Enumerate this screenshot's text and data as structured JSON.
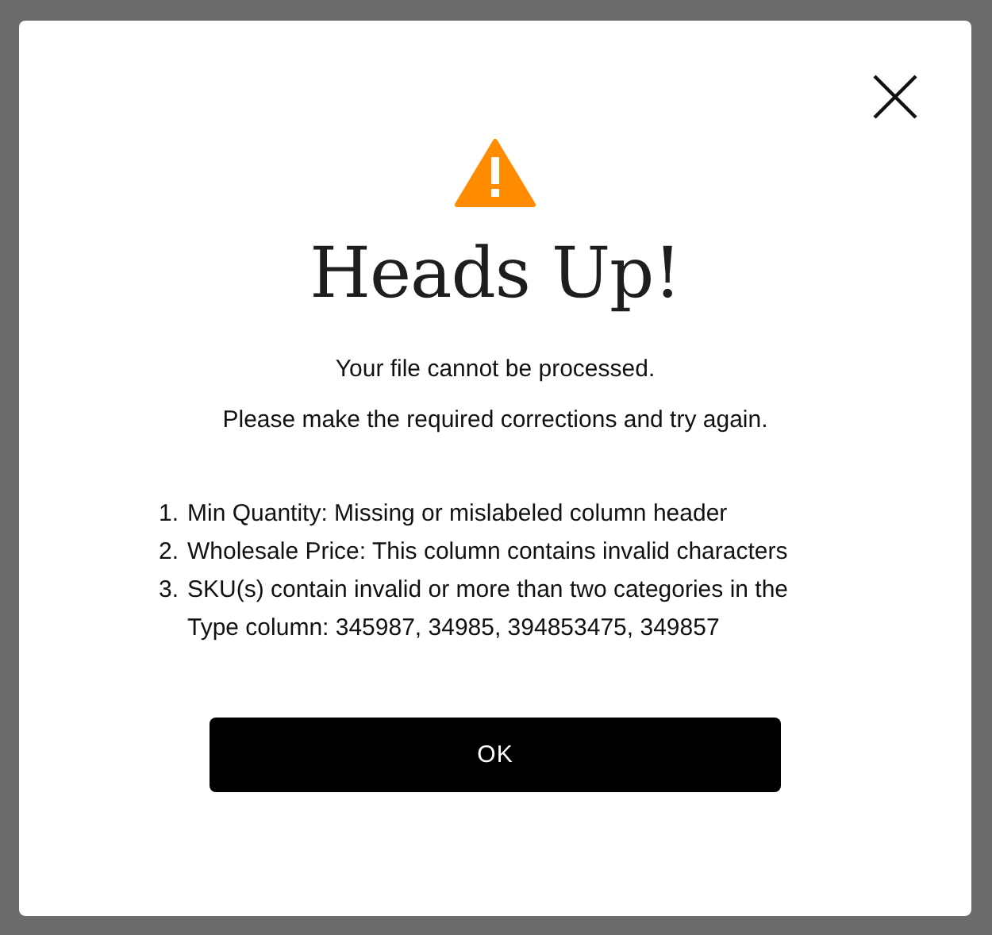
{
  "dialog": {
    "title": "Heads Up!",
    "messages": [
      "Your file cannot be processed.",
      "Please make the required corrections and try again."
    ],
    "errors": [
      {
        "number": "1.",
        "text": "Min Quantity: Missing or mislabeled column header"
      },
      {
        "number": "2.",
        "text": "Wholesale Price: This column contains invalid characters"
      },
      {
        "number": "3.",
        "text": "SKU(s) contain invalid or more than two categories in the Type column: 345987, 34985, 394853475, 349857"
      }
    ],
    "button": "OK"
  }
}
